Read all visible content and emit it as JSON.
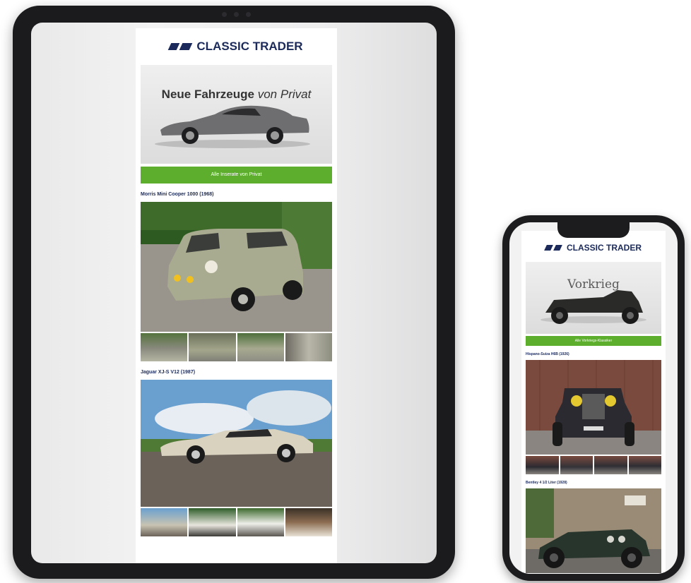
{
  "brand": {
    "name": "CLASSIC TRADER",
    "color": "#1b2a5a"
  },
  "accent": "#5cae2c",
  "tablet": {
    "hero": {
      "title_bold": "Neue Fahrzeuge",
      "title_italic": "von Privat"
    },
    "cta_label": "Alle Inserate von Privat",
    "listings": [
      {
        "title": "Morris Mini Cooper 1000 (1968)"
      },
      {
        "title": "Jaguar XJ-S V12 (1987)"
      }
    ]
  },
  "phone": {
    "hero": {
      "title": "Vorkrieg"
    },
    "cta_label": "Alle Vorkriegs-Klassiker",
    "listings": [
      {
        "title": "Hispano-Suiza H6B (1926)"
      },
      {
        "title": "Bentley 4 1/2 Liter (1928)"
      }
    ]
  }
}
